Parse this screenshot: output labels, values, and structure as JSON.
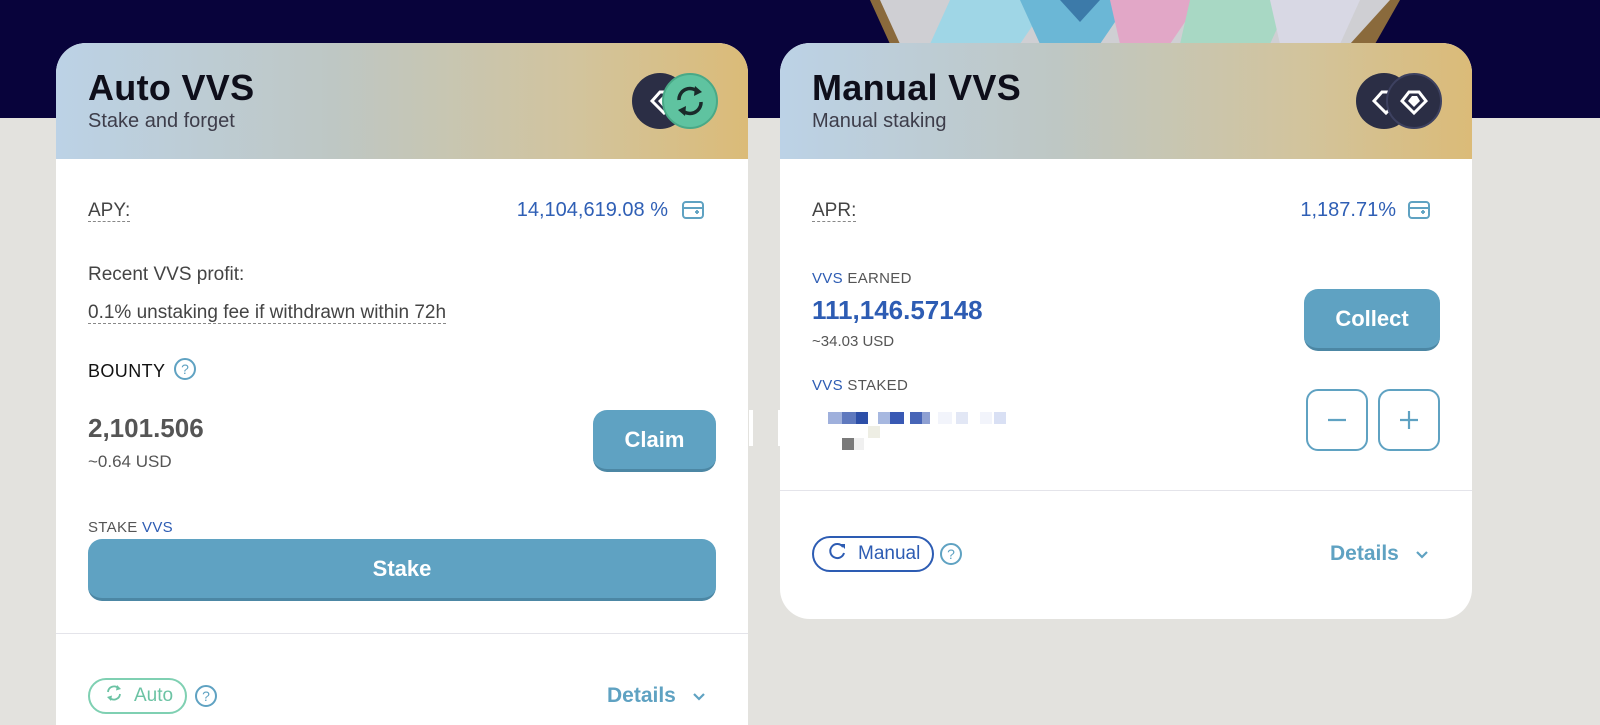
{
  "colors": {
    "brand_dark": "#08033b",
    "accent_blue": "#2d5cb3",
    "button_blue": "#5fa2c2",
    "auto_green": "#6cc3a4"
  },
  "auto_card": {
    "title": "Auto VVS",
    "subtitle": "Stake and forget",
    "token_icons": [
      "vvs-token-icon",
      "auto-compound-icon"
    ],
    "apy_label": "APY:",
    "apy_value": "14,104,619.08 %",
    "recent_profit_label": "Recent VVS profit:",
    "fee_note": "0.1% unstaking fee if withdrawn within 72h",
    "bounty_label": "BOUNTY",
    "bounty_value": "2,101.506",
    "bounty_usd": "~0.64 USD",
    "claim_label": "Claim",
    "stake_label_prefix": "STAKE",
    "stake_label_token": "VVS",
    "stake_button": "Stake",
    "tag_label": "Auto",
    "details_label": "Details"
  },
  "manual_card": {
    "title": "Manual VVS",
    "subtitle": "Manual staking",
    "token_icons": [
      "vvs-token-icon",
      "vvs-token-icon"
    ],
    "apr_label": "APR:",
    "apr_value": "1,187.71%",
    "earned_token": "VVS",
    "earned_label": "EARNED",
    "earned_value": "111,146.57148",
    "earned_usd": "~34.03 USD",
    "collect_label": "Collect",
    "staked_token": "VVS",
    "staked_label": "STAKED",
    "minus_icon": "minus-icon",
    "plus_icon": "plus-icon",
    "tag_label": "Manual",
    "details_label": "Details"
  }
}
